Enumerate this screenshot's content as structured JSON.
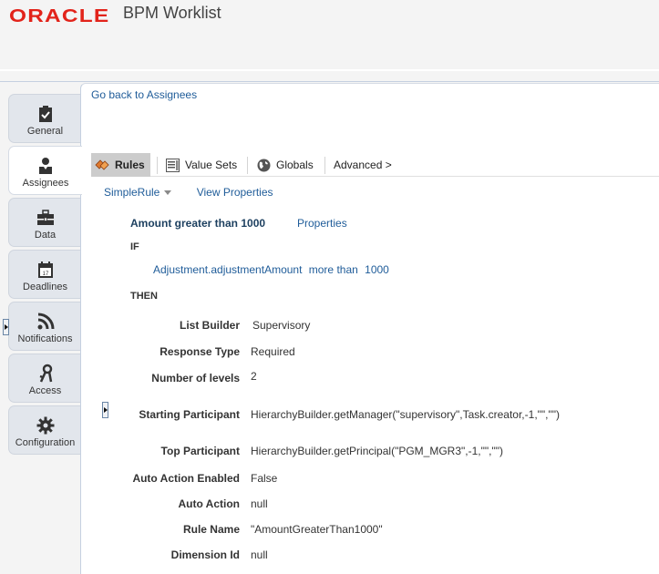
{
  "header": {
    "logo": "ORACLE",
    "app_title": "BPM Worklist"
  },
  "sidetabs": [
    {
      "label": "General",
      "icon": "clipboard-check-icon",
      "active": false
    },
    {
      "label": "Assignees",
      "icon": "user-icon",
      "active": true
    },
    {
      "label": "Data",
      "icon": "briefcase-icon",
      "active": false
    },
    {
      "label": "Deadlines",
      "icon": "calendar-icon",
      "active": false,
      "icon_text": "17"
    },
    {
      "label": "Notifications",
      "icon": "rss-icon",
      "active": false
    },
    {
      "label": "Access",
      "icon": "keys-icon",
      "active": false
    },
    {
      "label": "Configuration",
      "icon": "gear-icon",
      "active": false
    }
  ],
  "panel": {
    "back_link": "Go back to Assignees",
    "toolbar": {
      "rules": "Rules",
      "value_sets": "Value Sets",
      "globals": "Globals",
      "advanced": "Advanced >"
    },
    "rule_selector": "SimpleRule",
    "view_properties": "View Properties",
    "rule": {
      "title": "Amount greater than 1000",
      "properties_link": "Properties",
      "if_keyword": "IF",
      "condition": {
        "left": "Adjustment.adjustmentAmount",
        "operator": "more than",
        "right": "1000"
      },
      "then_keyword": "THEN",
      "fields": [
        {
          "label": "List Builder",
          "value": "Supervisory"
        },
        {
          "label": "Response Type",
          "value": "Required"
        },
        {
          "label": "Number of levels",
          "value": "2"
        },
        {
          "label": "Starting Participant",
          "value": "HierarchyBuilder.getManager(\"supervisory\",Task.creator,-1,\"\",\"\")"
        },
        {
          "label": "Top Participant",
          "value": "HierarchyBuilder.getPrincipal(\"PGM_MGR3\",-1,\"\",\"\")"
        },
        {
          "label": "Auto Action Enabled",
          "value": "False"
        },
        {
          "label": "Auto Action",
          "value": "null"
        },
        {
          "label": "Rule Name",
          "value": "\"AmountGreaterThan1000\""
        },
        {
          "label": "Dimension Id",
          "value": "null"
        }
      ]
    }
  },
  "colors": {
    "oracle_red": "#e2231a",
    "link_blue": "#1f5c99",
    "title_navy": "#1c3f5f"
  }
}
